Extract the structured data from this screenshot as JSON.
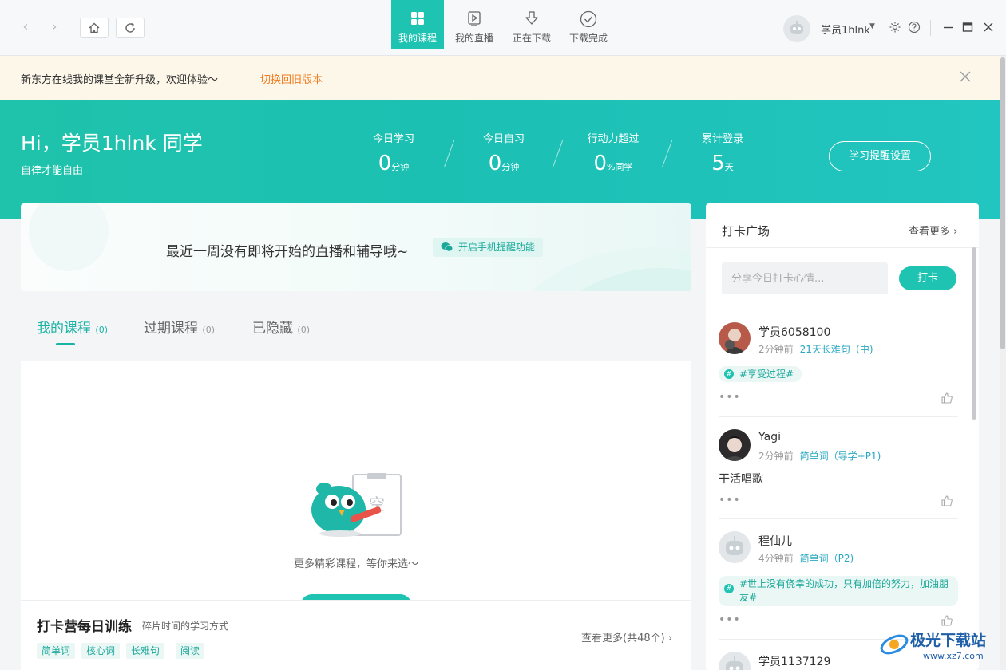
{
  "titlebar": {
    "tabs": [
      {
        "label": "我的课程",
        "icon": "grid-icon"
      },
      {
        "label": "我的直播",
        "icon": "live-play-icon"
      },
      {
        "label": "正在下载",
        "icon": "download-icon"
      },
      {
        "label": "下载完成",
        "icon": "check-circle-icon"
      }
    ],
    "username": "学员1hlnk"
  },
  "notice": {
    "text": "新东方在线我的课堂全新升级，欢迎体验～",
    "link": "切换回旧版本"
  },
  "hero": {
    "greeting": "Hi，学员1hlnk 同学",
    "motto": "自律才能自由",
    "stats": [
      {
        "label": "今日学习",
        "value": "0",
        "unit": "分钟"
      },
      {
        "label": "今日自习",
        "value": "0",
        "unit": "分钟"
      },
      {
        "label": "行动力超过",
        "value": "0",
        "unit": "%同学"
      },
      {
        "label": "累计登录",
        "value": "5",
        "unit": "天"
      }
    ],
    "remind_button": "学习提醒设置"
  },
  "live": {
    "text": "最近一周没有即将开始的直播和辅导哦~",
    "chip": "开启手机提醒功能"
  },
  "course_tabs": [
    {
      "label": "我的课程",
      "count": "(0)"
    },
    {
      "label": "过期课程",
      "count": "(0)"
    },
    {
      "label": "已隐藏",
      "count": "(0)"
    }
  ],
  "empty": {
    "art_text": "空",
    "text": "更多精彩课程，等你来选～"
  },
  "camp": {
    "title": "打卡营每日训练",
    "subtitle": "碎片时间的学习方式",
    "more": "查看更多(共48个)",
    "chips": [
      "简单词",
      "核心词",
      "长难句",
      "阅读"
    ]
  },
  "checkin": {
    "title": "打卡广场",
    "more": "查看更多",
    "input_placeholder": "分享今日打卡心情...",
    "button": "打卡",
    "posts": [
      {
        "name": "学员6058100",
        "time": "2分钟前",
        "course": "21天长难句（中)",
        "tag": "#享受过程#",
        "body": ""
      },
      {
        "name": "Yagi",
        "time": "2分钟前",
        "course": "简单词（导学+P1)",
        "tag": "",
        "body": "干活唱歌"
      },
      {
        "name": "程仙儿",
        "time": "4分钟前",
        "course": "简单词（P2)",
        "tag": "#世上没有侥幸的成功，只有加倍的努力，加油朋友#",
        "body": ""
      },
      {
        "name": "学员1137129",
        "time": "",
        "course": "",
        "tag": "",
        "body": ""
      }
    ]
  },
  "watermark": {
    "name": "极光下载站",
    "url": "www.xz7.com"
  },
  "colors": {
    "accent": "#1ec3b2",
    "notice_link": "#f07a1c",
    "notice_bg": "#fdf7ea"
  }
}
